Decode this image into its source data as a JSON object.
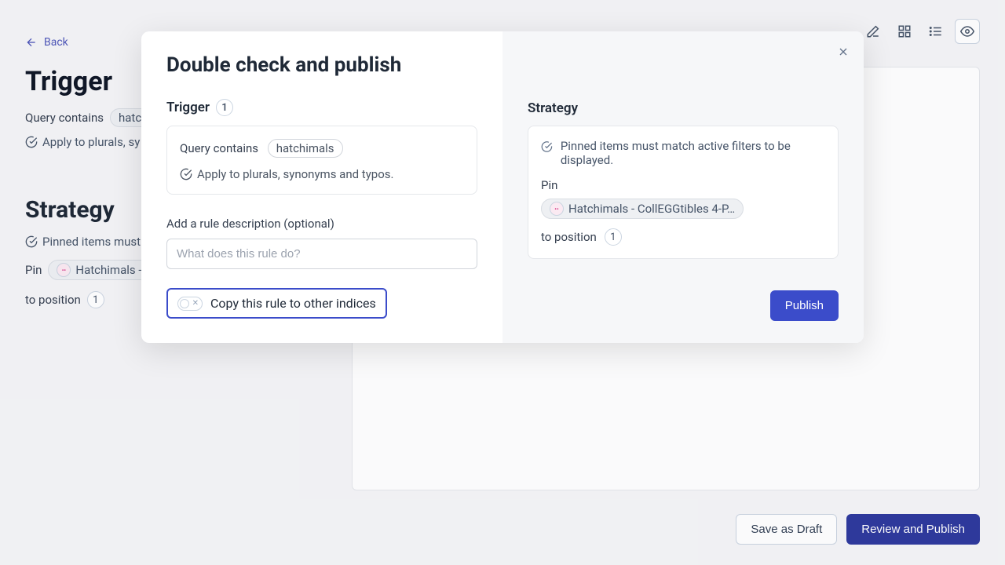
{
  "header": {
    "back_label": "Back"
  },
  "bg": {
    "trigger_title": "Trigger",
    "query_contains_label": "Query contains",
    "query_tag": "hatch",
    "apply_label": "Apply to plurals, sy",
    "strategy_title": "Strategy",
    "pinned_label": "Pinned items must",
    "pin_label": "Pin",
    "pin_item": "Hatchimals -",
    "to_position_label": "to position",
    "to_position_value": "1"
  },
  "footer": {
    "save_draft": "Save as Draft",
    "review_publish": "Review and Publish"
  },
  "modal": {
    "title": "Double check and publish",
    "trigger": {
      "title": "Trigger",
      "count": "1",
      "query_contains": "Query contains",
      "query_tag": "hatchimals",
      "apply": "Apply to plurals, synonyms and typos."
    },
    "desc_label": "Add a rule description (optional)",
    "desc_placeholder": "What does this rule do?",
    "copy_label": "Copy this rule to other indices",
    "strategy": {
      "title": "Strategy",
      "info": "Pinned items must match active filters to be displayed.",
      "pin_label": "Pin",
      "pin_item": "Hatchimals - CollEGGtibles 4-P…",
      "to_position": "to position",
      "position_value": "1"
    },
    "publish_label": "Publish"
  }
}
